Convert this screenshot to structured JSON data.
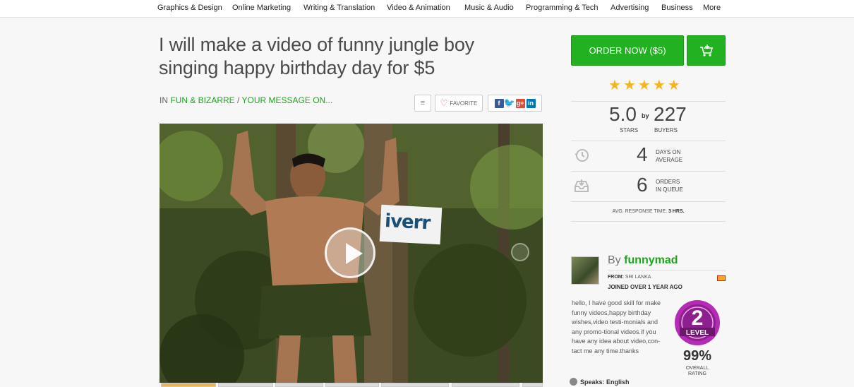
{
  "nav": {
    "items": [
      "Graphics & Design",
      "Online Marketing",
      "Writing & Translation",
      "Video & Animation",
      "Music & Audio",
      "Programming & Tech",
      "Advertising",
      "Business",
      "More"
    ]
  },
  "gig": {
    "title_line1": "I will make a video of funny jungle boy",
    "title_line2": "singing happy birthday day for $5",
    "category_prefix": "IN",
    "category_main": "FUN & BIZARRE",
    "category_sep": "/",
    "category_sub": "YOUR MESSAGE ON...",
    "favorite_label": "FAVORITE",
    "video_sign_text": "iverr"
  },
  "order": {
    "button_label": "ORDER NOW ($5)",
    "rating_stars": 5
  },
  "stats": {
    "rating_value": "5.0",
    "rating_unit": "STARS",
    "by": "by",
    "buyers_count": "227",
    "buyers_label": "BUYERS",
    "days_value": "4",
    "days_label_1": "DAYS ON",
    "days_label_2": "AVERAGE",
    "queue_value": "6",
    "queue_label_1": "ORDERS",
    "queue_label_2": "IN QUEUE",
    "response_label": "AVG. RESPONSE TIME:",
    "response_value": "3 HRS."
  },
  "seller": {
    "by_label": "By",
    "name": "funnymad",
    "from_label": "FROM:",
    "from_value": "SRI LANKA",
    "joined": "JOINED OVER 1 YEAR AGO",
    "description": "hello, I have good skill for make funny videos,happy birthday wishes,video testi-monials and any promo-tional videos.if you have any idea about video,con-tact me any time.thanks",
    "level_number": "2",
    "level_label": "LEVEL",
    "rating_pct": "99%",
    "rating_label_1": "OVERALL",
    "rating_label_2": "RATING",
    "speaks": "Speaks: English"
  },
  "colors": {
    "accent_green": "#21b121",
    "link_green": "#1ea31e",
    "star_gold": "#f5b51f",
    "badge_purple": "#8e1f8e"
  }
}
